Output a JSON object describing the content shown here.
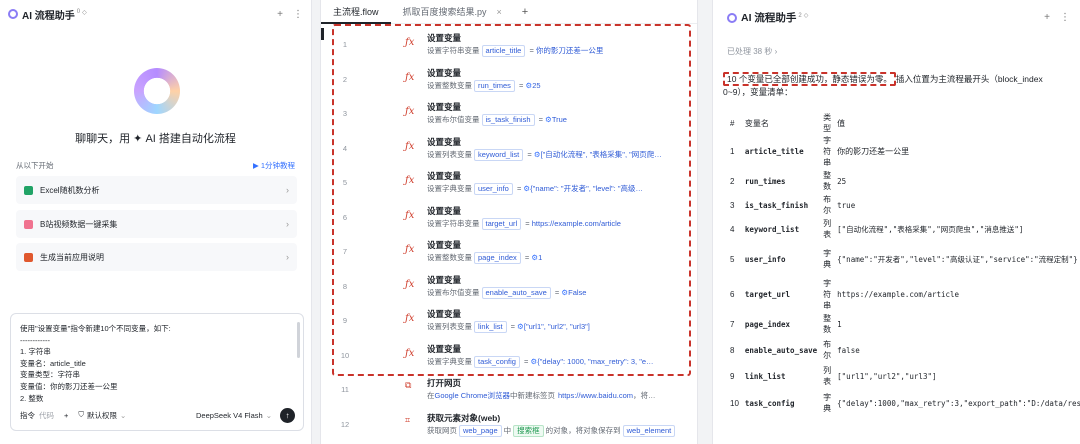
{
  "left": {
    "title": "AI 流程助手",
    "badge": "0",
    "slogan": "聊聊天，用 ✦ AI 搭建自动化流程",
    "start_label": "从以下开始",
    "tutorial_label": "▶ 1分钟教程",
    "quick_items": [
      {
        "label": "Excel随机数分析",
        "color": "#21a366"
      },
      {
        "label": "B站视频数据一键采集",
        "color": "#f0728f"
      },
      {
        "label": "生成当前应用说明",
        "color": "#e0582e"
      }
    ],
    "composer_lines": [
      "使用\"设置变量\"指令新建10个不同变量，如下:",
      "------------",
      "1. 字符串",
      "变量名：article_title",
      "变量类型：字符串",
      "变量值：你的影刀还差一公里",
      "2. 整数"
    ],
    "composer_cmd": "指令",
    "composer_code": "代码",
    "composer_plus": "+",
    "composer_perm": "默认权限",
    "model": "DeepSeek V4 Flash",
    "send": "↑"
  },
  "mid": {
    "tabs": [
      {
        "label": "主流程.flow",
        "active": true
      },
      {
        "label": "抓取百度搜索结果.py",
        "active": false
      }
    ],
    "rows": [
      {
        "num": "1",
        "title": "设置变量",
        "prefix": "设置字符串变量",
        "var": "article_title",
        "value": "你的影刀还差一公里",
        "gear": false
      },
      {
        "num": "2",
        "title": "设置变量",
        "prefix": "设置整数变量",
        "var": "run_times",
        "value": "25",
        "gear": true
      },
      {
        "num": "3",
        "title": "设置变量",
        "prefix": "设置布尔值变量",
        "var": "is_task_finish",
        "value": "True",
        "gear": true
      },
      {
        "num": "4",
        "title": "设置变量",
        "prefix": "设置列表变量",
        "var": "keyword_list",
        "value": "[\"自动化流程\", \"表格采集\", \"网页爬…",
        "gear": true
      },
      {
        "num": "5",
        "title": "设置变量",
        "prefix": "设置字典变量",
        "var": "user_info",
        "value": "{\"name\": \"开发者\", \"level\": \"高级…",
        "gear": true
      },
      {
        "num": "6",
        "title": "设置变量",
        "prefix": "设置字符串变量",
        "var": "target_url",
        "value": "https://example.com/article",
        "gear": false
      },
      {
        "num": "7",
        "title": "设置变量",
        "prefix": "设置整数变量",
        "var": "page_index",
        "value": "1",
        "gear": true
      },
      {
        "num": "8",
        "title": "设置变量",
        "prefix": "设置布尔值变量",
        "var": "enable_auto_save",
        "value": "False",
        "gear": true
      },
      {
        "num": "9",
        "title": "设置变量",
        "prefix": "设置列表变量",
        "var": "link_list",
        "value": "[\"url1\", \"url2\", \"url3\"]",
        "gear": true
      },
      {
        "num": "10",
        "title": "设置变量",
        "prefix": "设置字典变量",
        "var": "task_config",
        "value": "{\"delay\": 1000, \"max_retry\": 3, \"e…",
        "gear": true
      }
    ],
    "row11": {
      "num": "11",
      "title": "打开网页",
      "pre": "在",
      "browser": "Google Chrome浏览器",
      "mid": "中新建标签页",
      "url": "https://www.baidu.com",
      "tail": "，将…"
    },
    "row12": {
      "num": "12",
      "title": "获取元素对象(web)",
      "pre": "获取网页",
      "chip1": "web_page",
      "mid1": "中",
      "chip2": "搜索框",
      "mid2": "的对象，将对象保存到",
      "chip3": "web_element"
    }
  },
  "right": {
    "title": "AI 流程助手",
    "badge": "2",
    "processed": "已处理 38 秒 ›",
    "intro_highlight": "10 个变量已全部创建成功，静态错误为零。",
    "intro_rest_1": "插入位置为主流程最开头（block_index",
    "intro_rest_2": "0~9），变量清单：",
    "headers": [
      "#",
      "变量名",
      "类型",
      "值"
    ],
    "rows": [
      {
        "n": "1",
        "name": "article_title",
        "type": "字符串",
        "val": "你的影刀还差一公里"
      },
      {
        "n": "2",
        "name": "run_times",
        "type": "整数",
        "val": "25"
      },
      {
        "n": "3",
        "name": "is_task_finish",
        "type": "布尔",
        "val": "true"
      },
      {
        "n": "4",
        "name": "keyword_list",
        "type": "列表",
        "val": "[\"自动化流程\",\"表格采集\",\"网页爬虫\",\"消息推送\"]"
      },
      {
        "n": "5",
        "name": "user_info",
        "type": "字典",
        "val": "{\"name\":\"开发者\",\"level\":\"高级认证\",\"service\":\"流程定制\"}"
      },
      {
        "n": "6",
        "name": "target_url",
        "type": "字符串",
        "val": "https://example.com/article"
      },
      {
        "n": "7",
        "name": "page_index",
        "type": "整数",
        "val": "1"
      },
      {
        "n": "8",
        "name": "enable_auto_save",
        "type": "布尔",
        "val": "false"
      },
      {
        "n": "9",
        "name": "link_list",
        "type": "列表",
        "val": "[\"url1\",\"url2\",\"url3\"]"
      },
      {
        "n": "10",
        "name": "task_config",
        "type": "字典",
        "val": "{\"delay\":1000,\"max_retry\":3,\"export_path\":\"D:/data/result.xlsx\"}"
      }
    ]
  }
}
